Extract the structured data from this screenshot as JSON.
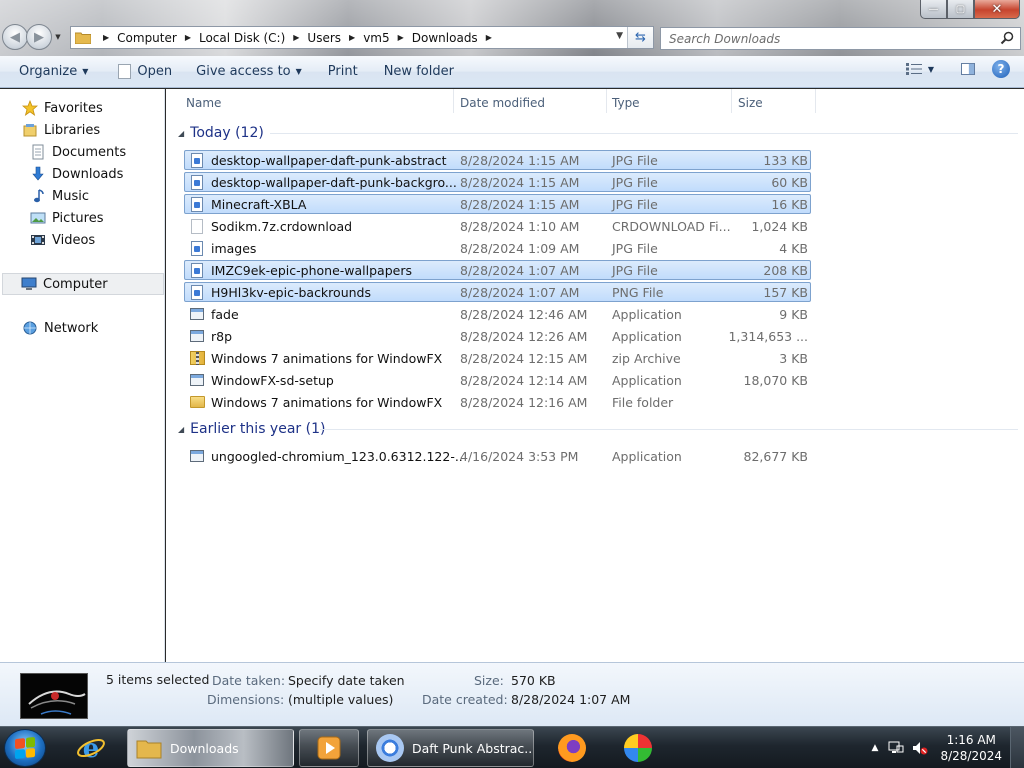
{
  "window": {
    "minimize_glyph": "—",
    "maximize_glyph": "▢",
    "close_glyph": "✕"
  },
  "address": {
    "segments": [
      "Computer",
      "Local Disk (C:)",
      "Users",
      "vm5",
      "Downloads"
    ]
  },
  "search": {
    "placeholder": "Search Downloads"
  },
  "toolbar": {
    "organize": "Organize",
    "open": "Open",
    "give_access": "Give access to",
    "print": "Print",
    "new_folder": "New folder",
    "help": "?"
  },
  "nav": {
    "favorites": "Favorites",
    "libraries": "Libraries",
    "documents": "Documents",
    "downloads": "Downloads",
    "music": "Music",
    "pictures": "Pictures",
    "videos": "Videos",
    "computer": "Computer",
    "network": "Network"
  },
  "columns": {
    "name": "Name",
    "date_modified": "Date modified",
    "type": "Type",
    "size": "Size"
  },
  "groups": {
    "today": "Today (12)",
    "earlier": "Earlier this year (1)"
  },
  "files": [
    {
      "name": "desktop-wallpaper-daft-punk-abstract",
      "date": "8/28/2024 1:15 AM",
      "type": "JPG File",
      "size": "133 KB",
      "selected": true,
      "icon": "image-file-icon"
    },
    {
      "name": "desktop-wallpaper-daft-punk-backgro...",
      "date": "8/28/2024 1:15 AM",
      "type": "JPG File",
      "size": "60 KB",
      "selected": true,
      "icon": "image-file-icon"
    },
    {
      "name": "Minecraft-XBLA",
      "date": "8/28/2024 1:15 AM",
      "type": "JPG File",
      "size": "16 KB",
      "selected": true,
      "icon": "image-file-icon"
    },
    {
      "name": "Sodikm.7z.crdownload",
      "date": "8/28/2024 1:10 AM",
      "type": "CRDOWNLOAD Fi...",
      "size": "1,024 KB",
      "selected": false,
      "icon": "blank-file-icon"
    },
    {
      "name": "images",
      "date": "8/28/2024 1:09 AM",
      "type": "JPG File",
      "size": "4 KB",
      "selected": false,
      "icon": "image-file-icon"
    },
    {
      "name": "IMZC9ek-epic-phone-wallpapers",
      "date": "8/28/2024 1:07 AM",
      "type": "JPG File",
      "size": "208 KB",
      "selected": true,
      "icon": "image-file-icon"
    },
    {
      "name": "H9Hl3kv-epic-backrounds",
      "date": "8/28/2024 1:07 AM",
      "type": "PNG File",
      "size": "157 KB",
      "selected": true,
      "icon": "image-file-icon"
    },
    {
      "name": "fade",
      "date": "8/28/2024 12:46 AM",
      "type": "Application",
      "size": "9 KB",
      "selected": false,
      "icon": "application-icon"
    },
    {
      "name": "r8p",
      "date": "8/28/2024 12:26 AM",
      "type": "Application",
      "size": "1,314,653 ...",
      "selected": false,
      "icon": "application-icon"
    },
    {
      "name": "Windows 7 animations for WindowFX",
      "date": "8/28/2024 12:15 AM",
      "type": "zip Archive",
      "size": "3 KB",
      "selected": false,
      "icon": "zip-archive-icon"
    },
    {
      "name": "WindowFX-sd-setup",
      "date": "8/28/2024 12:14 AM",
      "type": "Application",
      "size": "18,070 KB",
      "selected": false,
      "icon": "setup-icon"
    },
    {
      "name": "Windows 7 animations for WindowFX",
      "date": "8/28/2024 12:16 AM",
      "type": "File folder",
      "size": "",
      "selected": false,
      "icon": "folder-icon"
    }
  ],
  "earlier_files": [
    {
      "name": "ungoogled-chromium_123.0.6312.122-...",
      "date": "4/16/2024 3:53 PM",
      "type": "Application",
      "size": "82,677 KB",
      "selected": false,
      "icon": "installer-icon"
    }
  ],
  "details": {
    "selection": "5 items selected",
    "date_taken_label": "Date taken:",
    "date_taken_value": "Specify date taken",
    "dimensions_label": "Dimensions:",
    "dimensions_value": "(multiple values)",
    "size_label": "Size:",
    "size_value": "570 KB",
    "date_created_label": "Date created:",
    "date_created_value": "8/28/2024 1:07 AM"
  },
  "taskbar": {
    "downloads": "Downloads",
    "browser": "Daft Punk Abstrac...",
    "time": "1:16 AM",
    "date": "8/28/2024"
  }
}
